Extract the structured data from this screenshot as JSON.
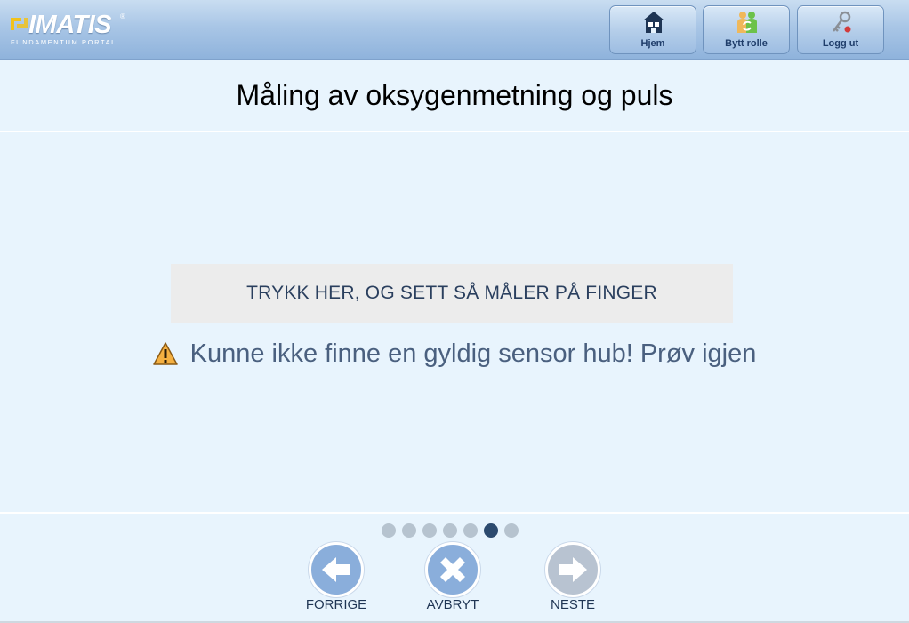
{
  "header": {
    "logo": {
      "name": "IMATIS",
      "registered": "®",
      "subtitle": "FUNDAMENTUM PORTAL",
      "mark_color": "#f2c21b"
    },
    "buttons": [
      {
        "label": "Hjem",
        "icon": "home-icon"
      },
      {
        "label": "Bytt rolle",
        "icon": "switch-role-icon"
      },
      {
        "label": "Logg ut",
        "icon": "key-logout-icon"
      }
    ]
  },
  "page": {
    "title": "Måling av oksygenmetning og puls"
  },
  "main": {
    "measure_button_label": "TRYKK HER, OG SETT SÅ MÅLER PÅ FINGER",
    "error_message": "Kunne ikke finne en gyldig sensor hub! Prøv igjen",
    "error_icon": "warning-icon"
  },
  "progress": {
    "total_steps": 7,
    "current_step": 6
  },
  "nav": {
    "prev_label": "FORRIGE",
    "cancel_label": "AVBRYT",
    "next_label": "NESTE",
    "next_enabled": false
  },
  "colors": {
    "background": "#e8f4fd",
    "nav_button": "#8aaedb",
    "nav_button_disabled": "#b8c3d1",
    "active_dot": "#2c4a6e",
    "inactive_dot": "#b6c3cf"
  }
}
